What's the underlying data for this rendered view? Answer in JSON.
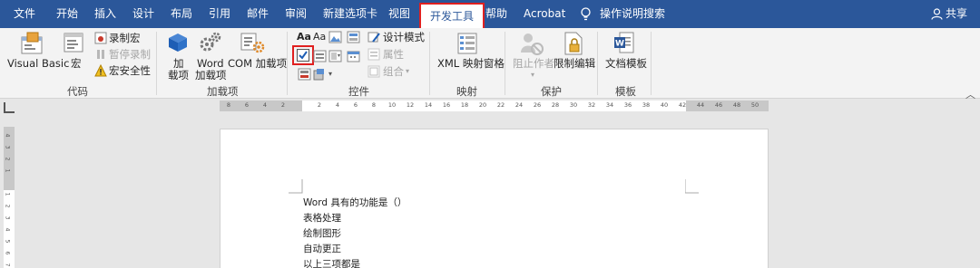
{
  "menu": {
    "tabs": [
      "文件",
      "开始",
      "插入",
      "设计",
      "布局",
      "引用",
      "邮件",
      "审阅",
      "新建选项卡",
      "视图",
      "开发工具",
      "帮助",
      "Acrobat"
    ],
    "active_tab": "开发工具",
    "tell_me": "操作说明搜索",
    "share": "共享"
  },
  "ribbon": {
    "code": {
      "visual_basic": "Visual Basic",
      "macros": "宏",
      "record_macro": "录制宏",
      "pause_recording": "暂停录制",
      "macro_security": "宏安全性",
      "group_label": "代码"
    },
    "addins": {
      "addins_line1": "加",
      "addins_line2": "载项",
      "word_addins_line1": "Word",
      "word_addins_line2": "加载项",
      "com_addins": "COM 加载项",
      "group_label": "加载项"
    },
    "controls": {
      "aa1": "Aa",
      "aa2": "Aa",
      "design_mode": "设计模式",
      "properties": "属性",
      "group": "组合",
      "group_label": "控件"
    },
    "mapping": {
      "xml_mapping": "XML 映射窗格",
      "group_label": "映射"
    },
    "protect": {
      "block_authors": "阻止作者",
      "restrict_editing": "限制编辑",
      "group_label": "保护"
    },
    "templates": {
      "document_template": "文档模板",
      "group_label": "模板"
    }
  },
  "ruler": {
    "ticks": [
      "8",
      "6",
      "4",
      "2",
      "",
      "2",
      "4",
      "6",
      "8",
      "10",
      "12",
      "14",
      "16",
      "18",
      "20",
      "22",
      "24",
      "26",
      "28",
      "30",
      "32",
      "34",
      "36",
      "38",
      "40",
      "42",
      "44",
      "46",
      "48",
      "50"
    ],
    "vticks": [
      "4",
      "3",
      "2",
      "1",
      "",
      "1",
      "2",
      "3",
      "4",
      "5",
      "6",
      "7"
    ]
  },
  "document": {
    "lines": [
      "Word 具有的功能是（）",
      "表格处理",
      "绘制图形",
      "自动更正",
      "以上三项都是"
    ]
  },
  "colors": {
    "title_bar": "#2b579a",
    "highlight_border": "#e02020"
  }
}
